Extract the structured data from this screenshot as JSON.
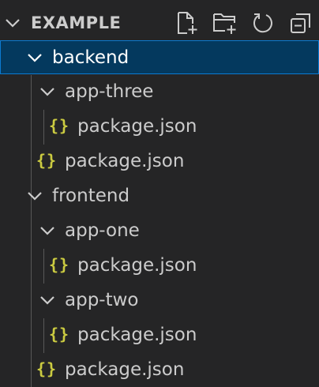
{
  "header": {
    "title": "EXAMPLE",
    "actions": [
      {
        "name": "new-file",
        "icon": "new-file-icon"
      },
      {
        "name": "new-folder",
        "icon": "new-folder-icon"
      },
      {
        "name": "refresh",
        "icon": "refresh-icon"
      },
      {
        "name": "collapse-all",
        "icon": "collapse-all-icon"
      }
    ]
  },
  "tree": {
    "items": [
      {
        "label": "backend",
        "type": "folder",
        "expanded": true,
        "selected": true
      },
      {
        "label": "app-three",
        "type": "folder",
        "expanded": true
      },
      {
        "label": "package.json",
        "type": "json-file"
      },
      {
        "label": "package.json",
        "type": "json-file"
      },
      {
        "label": "frontend",
        "type": "folder",
        "expanded": true
      },
      {
        "label": "app-one",
        "type": "folder",
        "expanded": true
      },
      {
        "label": "package.json",
        "type": "json-file"
      },
      {
        "label": "app-two",
        "type": "folder",
        "expanded": true
      },
      {
        "label": "package.json",
        "type": "json-file"
      },
      {
        "label": "package.json",
        "type": "json-file"
      }
    ],
    "json_icon_glyph": "{}"
  },
  "colors": {
    "background": "#252526",
    "selected_background": "#04395e",
    "selected_border": "#0b7ad1",
    "json_icon": "#cbcb41",
    "text": "#cccccc"
  }
}
